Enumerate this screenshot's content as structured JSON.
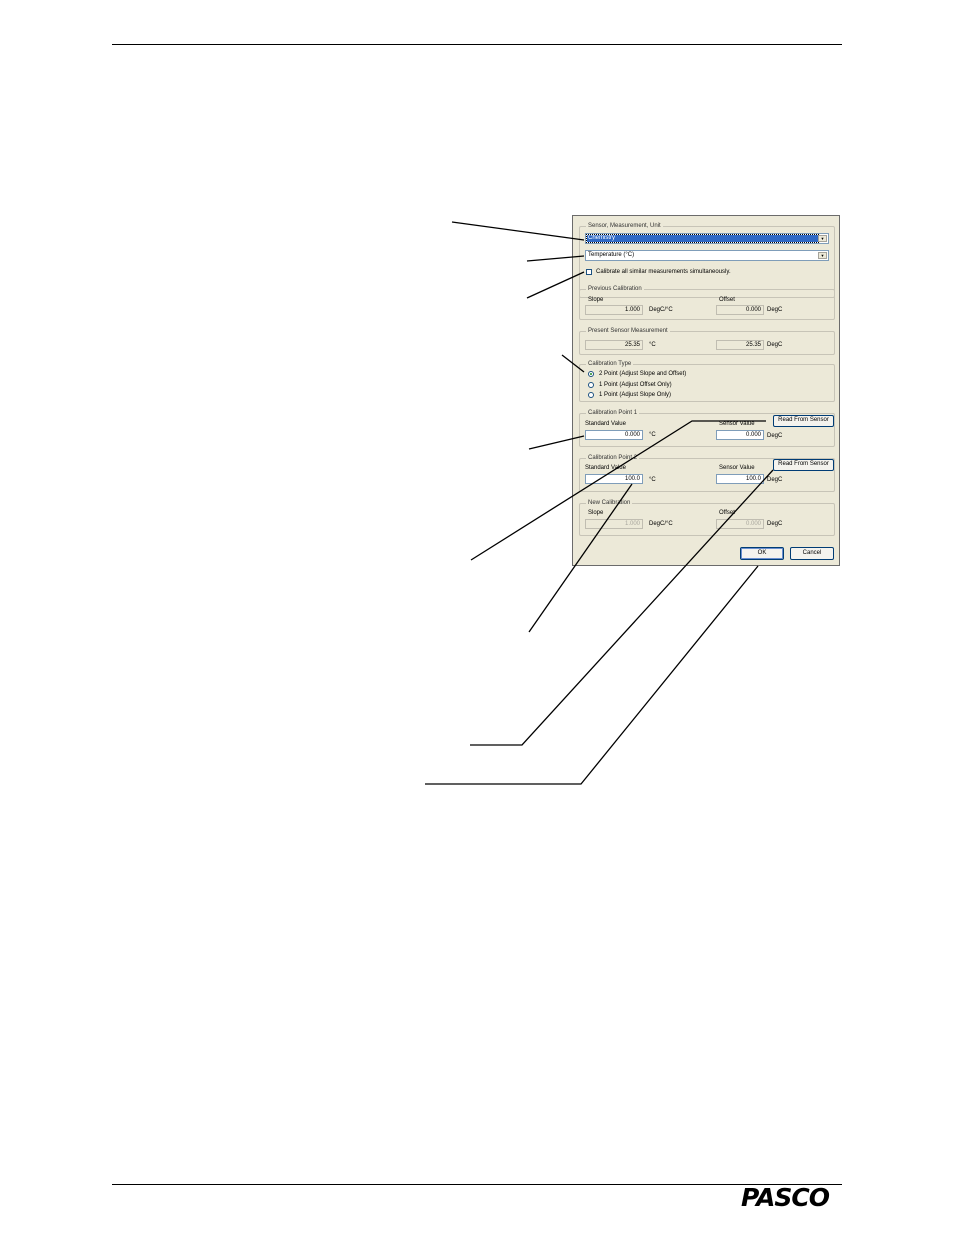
{
  "page": {
    "logo": "PASCO"
  },
  "dialog": {
    "sensor_group": {
      "title": "Sensor, Measurement, Unit",
      "sensor_select": "Chemistry",
      "measurement_select": "Temperature (°C)",
      "calibrate_all_label": "Calibrate all similar measurements simultaneously.",
      "calibrate_all_checked": false
    },
    "previous_calibration": {
      "title": "Previous Calibration",
      "slope_label": "Slope",
      "slope_value": "1.000",
      "slope_unit": "DegC/°C",
      "offset_label": "Offset",
      "offset_value": "0.000",
      "offset_unit": "DegC"
    },
    "present_measurement": {
      "title": "Present Sensor Measurement",
      "value1": "25.35",
      "unit1": "°C",
      "value2": "25.35",
      "unit2": "DegC"
    },
    "calibration_type": {
      "title": "Calibration Type",
      "options": [
        {
          "label": "2 Point (Adjust Slope and Offset)",
          "selected": true
        },
        {
          "label": "1 Point (Adjust Offset Only)",
          "selected": false
        },
        {
          "label": "1 Point (Adjust Slope Only)",
          "selected": false
        }
      ]
    },
    "point1": {
      "title": "Calibration Point 1",
      "standard_label": "Standard Value",
      "standard_value": "0.000",
      "standard_unit": "°C",
      "sensor_label": "Sensor Value",
      "sensor_value": "0.000",
      "sensor_unit": "DegC",
      "read_button": "Read From Sensor"
    },
    "point2": {
      "title": "Calibration Point 2",
      "standard_label": "Standard Value",
      "standard_value": "100.0",
      "standard_unit": "°C",
      "sensor_label": "Sensor Value",
      "sensor_value": "100.0",
      "sensor_unit": "DegC",
      "read_button": "Read From Sensor"
    },
    "new_calibration": {
      "title": "New Calibration",
      "slope_label": "Slope",
      "slope_value": "1.000",
      "slope_unit": "DegC/°C",
      "offset_label": "Offset",
      "offset_value": "0.000",
      "offset_unit": "DegC"
    },
    "ok_button": "OK",
    "cancel_button": "Cancel"
  },
  "colors": {
    "dialog_bg": "#ece9d8",
    "selection": "#316ac5",
    "field_border": "#7f9db9"
  }
}
